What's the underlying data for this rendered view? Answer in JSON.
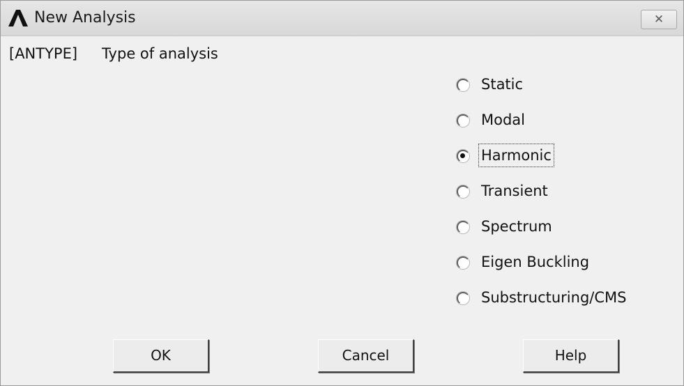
{
  "window": {
    "title": "New Analysis",
    "close_symbol": "✕",
    "app_icon": "ansys-logo-icon"
  },
  "prompt": {
    "code": "[ANTYPE]",
    "text": "Type of analysis"
  },
  "analysis_types": [
    {
      "label": "Static",
      "selected": false
    },
    {
      "label": "Modal",
      "selected": false
    },
    {
      "label": "Harmonic",
      "selected": true
    },
    {
      "label": "Transient",
      "selected": false
    },
    {
      "label": "Spectrum",
      "selected": false
    },
    {
      "label": "Eigen Buckling",
      "selected": false
    },
    {
      "label": "Substructuring/CMS",
      "selected": false
    }
  ],
  "buttons": {
    "ok": "OK",
    "cancel": "Cancel",
    "help": "Help"
  }
}
